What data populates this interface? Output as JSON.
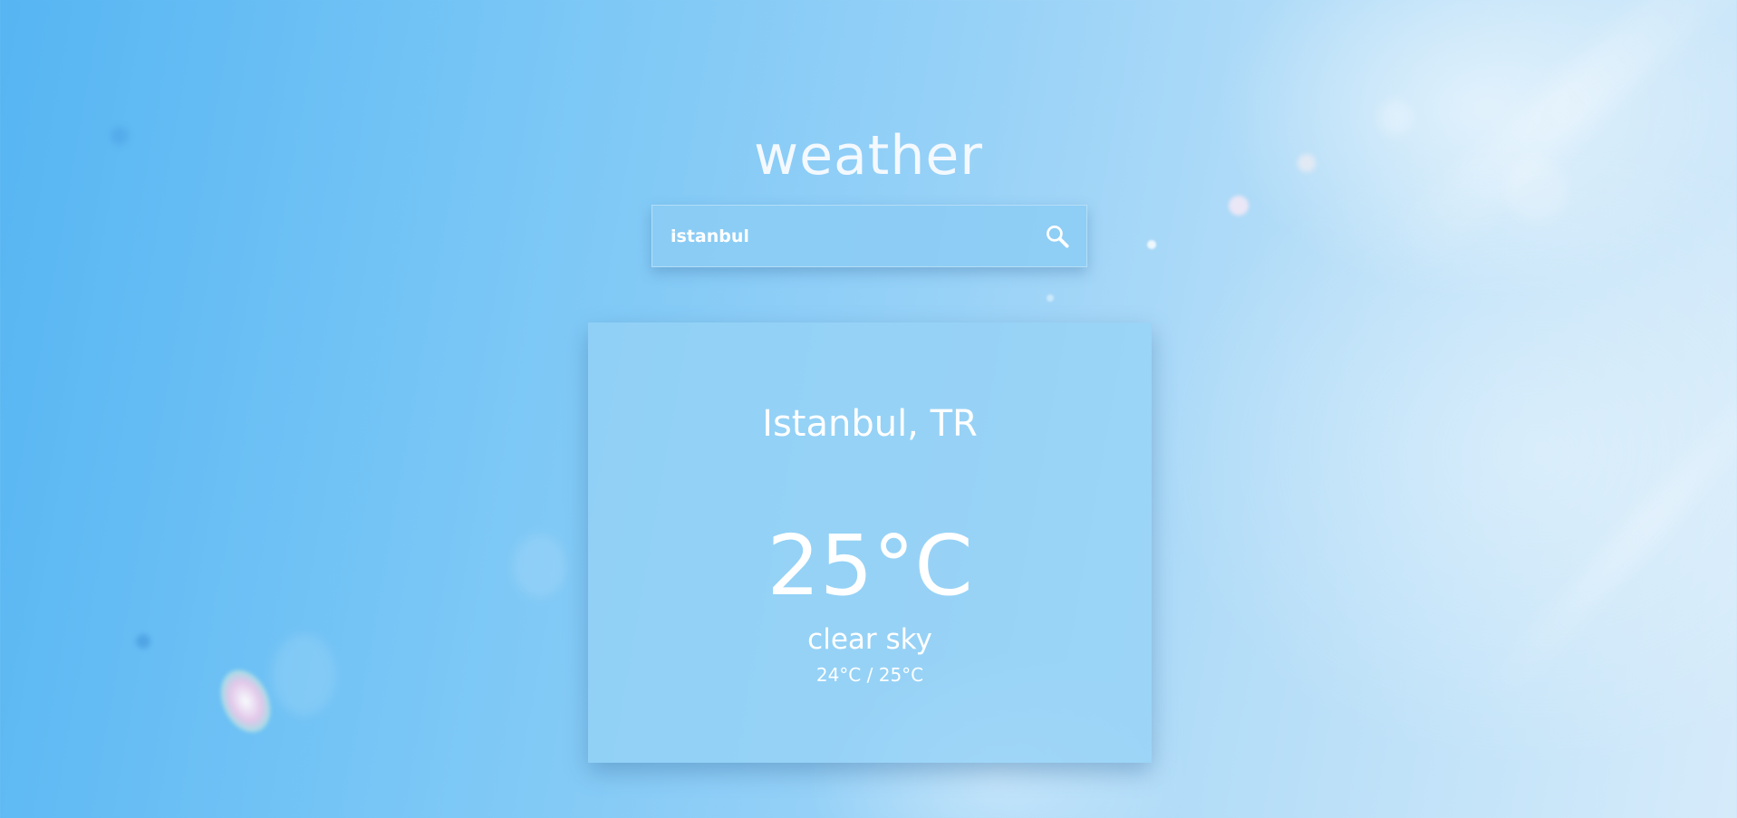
{
  "app": {
    "title": "weather"
  },
  "search": {
    "value": "istanbul",
    "icon": "search-icon"
  },
  "weather": {
    "city": "Istanbul, TR",
    "temperature": "25°C",
    "description": "clear sky",
    "range": "24°C / 25°C"
  },
  "colors": {
    "text": "#ffffff",
    "background_light": "#d6ebfa",
    "background_dark": "#56b5f2"
  }
}
